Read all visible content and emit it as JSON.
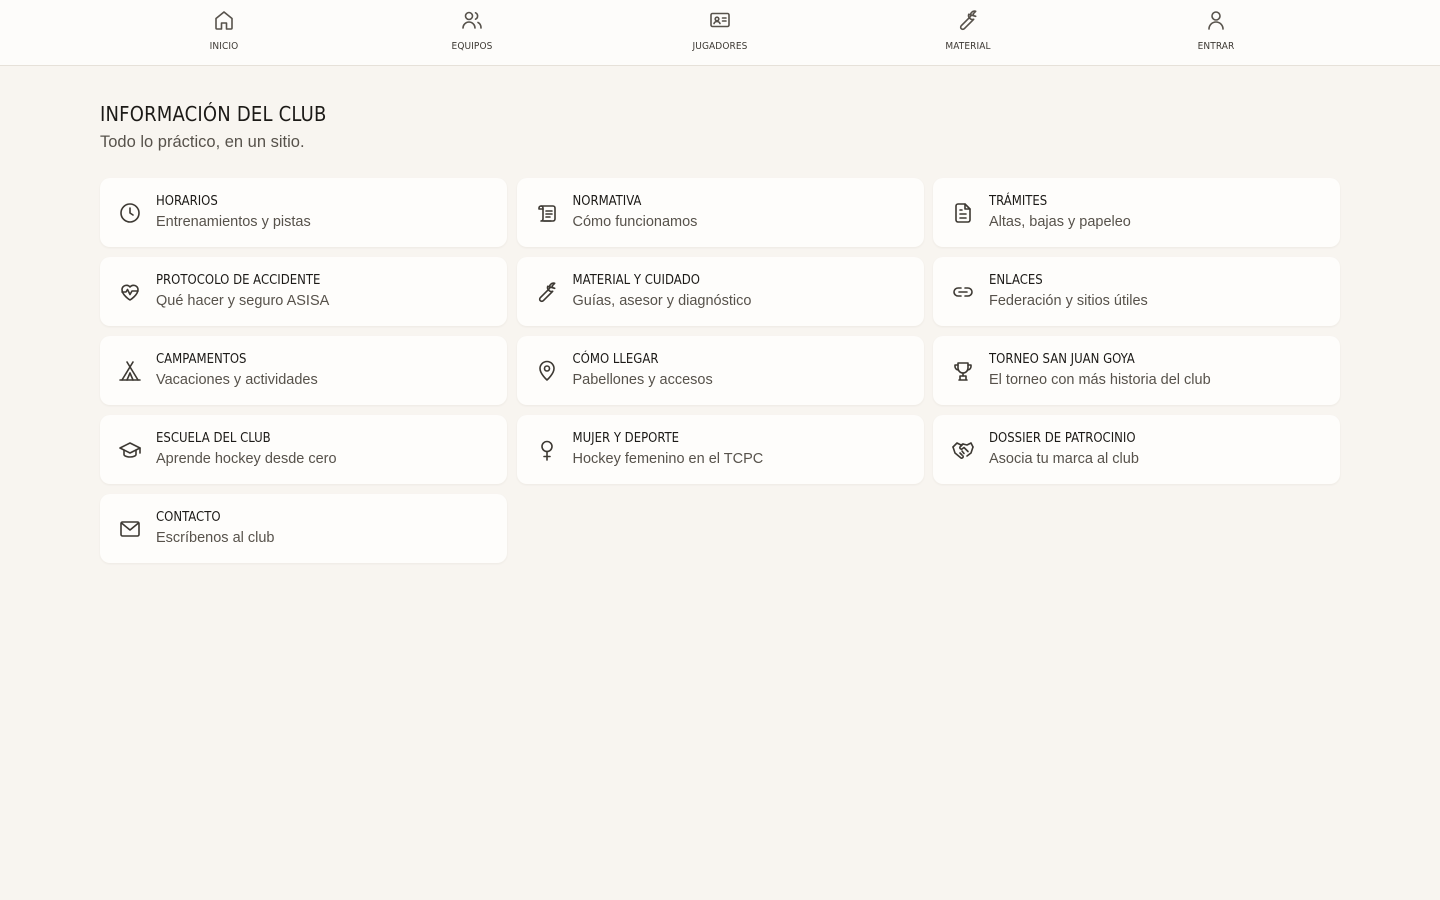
{
  "nav": {
    "items": [
      {
        "label": "INICIO",
        "icon": "home-icon"
      },
      {
        "label": "EQUIPOS",
        "icon": "users-icon"
      },
      {
        "label": "JUGADORES",
        "icon": "id-card-icon"
      },
      {
        "label": "MATERIAL",
        "icon": "wrench-icon"
      },
      {
        "label": "ENTRAR",
        "icon": "user-icon"
      }
    ]
  },
  "header": {
    "title": "INFORMACIÓN DEL CLUB",
    "subtitle": "Todo lo práctico, en un sitio."
  },
  "cards": [
    {
      "title": "HORARIOS",
      "description": "Entrenamientos y pistas",
      "icon": "clock-icon"
    },
    {
      "title": "NORMATIVA",
      "description": "Cómo funcionamos",
      "icon": "scroll-icon"
    },
    {
      "title": "TRÁMITES",
      "description": "Altas, bajas y papeleo",
      "icon": "document-icon"
    },
    {
      "title": "PROTOCOLO DE ACCIDENTE",
      "description": "Qué hacer y seguro ASISA",
      "icon": "heart-pulse-icon"
    },
    {
      "title": "MATERIAL Y CUIDADO",
      "description": "Guías, asesor y diagnóstico",
      "icon": "wrench-icon"
    },
    {
      "title": "ENLACES",
      "description": "Federación y sitios útiles",
      "icon": "link-icon"
    },
    {
      "title": "CAMPAMENTOS",
      "description": "Vacaciones y actividades",
      "icon": "tent-icon"
    },
    {
      "title": "CÓMO LLEGAR",
      "description": "Pabellones y accesos",
      "icon": "map-pin-icon"
    },
    {
      "title": "TORNEO SAN JUAN GOYA",
      "description": "El torneo con más historia del club",
      "icon": "trophy-icon"
    },
    {
      "title": "ESCUELA DEL CLUB",
      "description": "Aprende hockey desde cero",
      "icon": "graduation-cap-icon"
    },
    {
      "title": "MUJER Y DEPORTE",
      "description": "Hockey femenino en el TCPC",
      "icon": "venus-icon"
    },
    {
      "title": "DOSSIER DE PATROCINIO",
      "description": "Asocia tu marca al club",
      "icon": "handshake-icon"
    },
    {
      "title": "CONTACTO",
      "description": "Escríbenos al club",
      "icon": "mail-icon"
    }
  ]
}
